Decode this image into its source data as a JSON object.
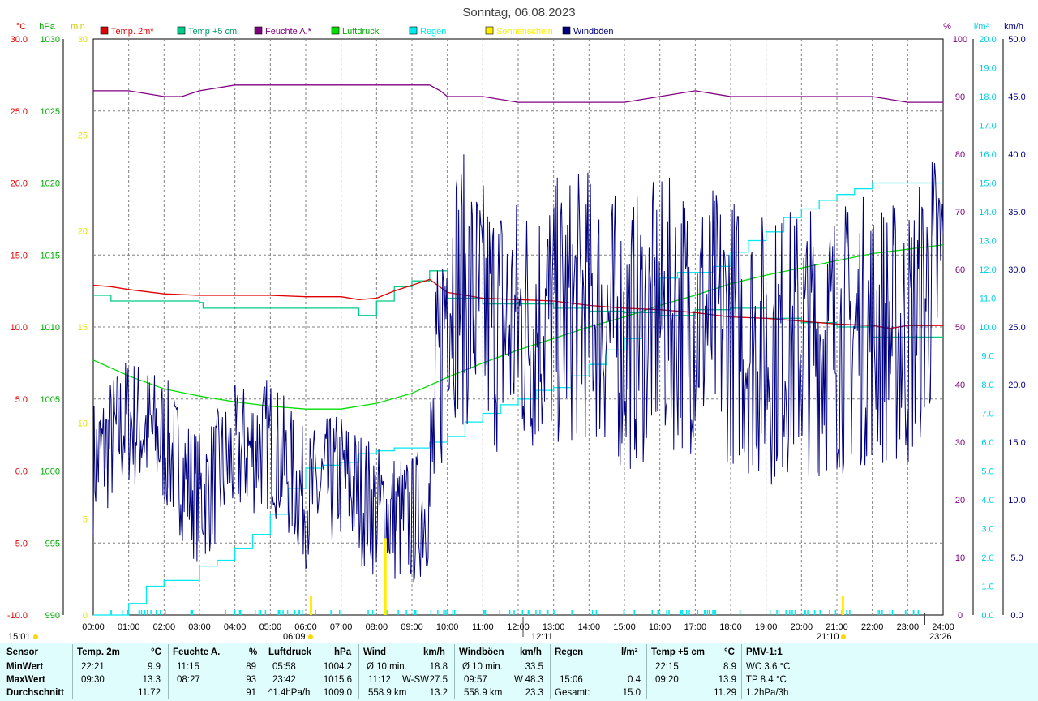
{
  "title": "Sonntag, 06.08.2023",
  "colors": {
    "temp2m": "#e00000",
    "temp5cm": "#00cc88",
    "humidity": "#800080",
    "pressure": "#00dd00",
    "rain": "#00e8f0",
    "sun": "#ffee00",
    "gusts": "#000080",
    "grid": "#808080"
  },
  "legend": [
    {
      "label": "Temp. 2m*",
      "color": "#e00000"
    },
    {
      "label": "Temp +5 cm",
      "color": "#00cc88"
    },
    {
      "label": "Feuchte A.*",
      "color": "#800080"
    },
    {
      "label": "Luftdruck",
      "color": "#00dd00"
    },
    {
      "label": "Regen",
      "color": "#00e8f0"
    },
    {
      "label": "Sonnenschein",
      "color": "#ffee00"
    },
    {
      "label": "Windböen",
      "color": "#000080"
    }
  ],
  "axes": {
    "temp": {
      "unit": "°C",
      "min": -10,
      "max": 30,
      "ticks": [
        "30.0",
        "25.0",
        "20.0",
        "15.0",
        "10.0",
        "5.0",
        "0.0",
        "-5.0",
        "-10.0"
      ]
    },
    "pressure": {
      "unit": "hPa",
      "min": 990,
      "max": 1030,
      "ticks": [
        "1030",
        "1025",
        "1020",
        "1015",
        "1010",
        "1005",
        "1000",
        "995",
        "990"
      ]
    },
    "sun": {
      "unit": "min",
      "min": 0,
      "max": 30,
      "ticks": [
        "30",
        "25",
        "20",
        "15",
        "10",
        "5",
        "0"
      ]
    },
    "humidity": {
      "unit": "%",
      "min": 0,
      "max": 100,
      "ticks": [
        "100",
        "90",
        "80",
        "70",
        "60",
        "50",
        "40",
        "30",
        "20",
        "10",
        "0"
      ]
    },
    "rain": {
      "unit": "l/m²",
      "min": 0,
      "max": 20,
      "ticks": [
        "20.0",
        "19.0",
        "18.0",
        "17.0",
        "16.0",
        "15.0",
        "14.0",
        "13.0",
        "12.0",
        "11.0",
        "10.0",
        "9.0",
        "8.0",
        "7.0",
        "6.0",
        "5.0",
        "4.0",
        "3.0",
        "2.0",
        "1.0",
        "0.0"
      ]
    },
    "wind": {
      "unit": "km/h",
      "min": 0,
      "max": 50,
      "ticks": [
        "50.0",
        "45.0",
        "40.0",
        "35.0",
        "30.0",
        "25.0",
        "20.0",
        "15.0",
        "10.0",
        "5.0",
        "0.0"
      ]
    },
    "x_ticks": [
      "00:00",
      "01:00",
      "02:00",
      "03:00",
      "04:00",
      "05:00",
      "06:00",
      "07:00",
      "08:00",
      "09:00",
      "10:00",
      "11:00",
      "12:00",
      "13:00",
      "14:00",
      "15:00",
      "16:00",
      "17:00",
      "18:00",
      "19:00",
      "20:00",
      "21:00",
      "22:00",
      "23:00",
      "24:00"
    ]
  },
  "markers": {
    "sunrise": "06:09",
    "noon": "12:11",
    "sunset": "21:10",
    "other": "23:26",
    "time": "15:01"
  },
  "chart_data": {
    "type": "line",
    "x_unit": "hour",
    "series": [
      {
        "name": "Temp. 2m*",
        "axis": "temp",
        "x": [
          0,
          0.5,
          1,
          2,
          3,
          4,
          5,
          6,
          7,
          7.5,
          8,
          8.5,
          9,
          9.5,
          10,
          11,
          12,
          13,
          14,
          15,
          16,
          17,
          18,
          19,
          20,
          21,
          22,
          22.5,
          23,
          24
        ],
        "y": [
          12.9,
          12.8,
          12.6,
          12.3,
          12.2,
          12.2,
          12.2,
          12.1,
          12.1,
          11.9,
          12.0,
          12.5,
          12.9,
          13.3,
          12.4,
          12.0,
          11.9,
          11.8,
          11.5,
          11.3,
          11.2,
          11.0,
          10.7,
          10.6,
          10.4,
          10.2,
          10.1,
          9.9,
          10.1,
          10.1
        ]
      },
      {
        "name": "Temp +5 cm",
        "axis": "temp",
        "x": [
          0,
          0.5,
          1,
          2,
          3,
          3.1,
          4,
          5,
          6,
          7,
          7.5,
          8,
          8.5,
          9,
          9.5,
          10,
          11,
          12,
          13,
          14,
          15,
          16,
          17,
          18,
          19,
          20,
          21,
          22,
          23,
          24
        ],
        "y": [
          12.2,
          11.8,
          11.8,
          11.8,
          11.7,
          11.3,
          11.3,
          11.3,
          11.3,
          11.3,
          10.8,
          11.8,
          12.8,
          13.2,
          13.9,
          12.0,
          11.6,
          11.6,
          11.3,
          11.1,
          11.0,
          10.8,
          11.2,
          11.3,
          10.6,
          10.3,
          10.0,
          9.3,
          9.3,
          9.3
        ]
      },
      {
        "name": "Feuchte A.*",
        "axis": "humidity",
        "x": [
          0,
          1,
          2,
          2.5,
          3,
          4,
          5,
          6,
          7,
          8,
          9,
          9.5,
          9.8,
          10,
          11,
          12,
          13,
          14,
          15,
          16,
          17,
          18,
          19,
          20,
          21,
          22,
          23,
          24
        ],
        "y": [
          91,
          91,
          90,
          90,
          91,
          92,
          92,
          92,
          92,
          92,
          92,
          92,
          91,
          90,
          90,
          89,
          89,
          89,
          89,
          90,
          91,
          90,
          90,
          90,
          90,
          90,
          89,
          89
        ]
      },
      {
        "name": "Luftdruck",
        "axis": "pressure",
        "x": [
          0,
          1,
          2,
          3,
          4,
          5,
          6,
          7,
          8,
          9,
          10,
          11,
          12,
          13,
          14,
          15,
          16,
          17,
          18,
          19,
          20,
          21,
          22,
          23,
          24
        ],
        "y": [
          1007.7,
          1006.6,
          1005.7,
          1005.2,
          1004.8,
          1004.5,
          1004.3,
          1004.3,
          1004.7,
          1005.4,
          1006.5,
          1007.5,
          1008.4,
          1009.2,
          1010.0,
          1010.7,
          1011.5,
          1012.2,
          1013.0,
          1013.6,
          1014.1,
          1014.6,
          1015.1,
          1015.4,
          1015.7
        ]
      },
      {
        "name": "Regen",
        "axis": "rain",
        "x": [
          0,
          0.5,
          1,
          1.5,
          2,
          2.5,
          3,
          3.5,
          4,
          4.5,
          5,
          5.5,
          6,
          6.5,
          7,
          7.5,
          8,
          8.5,
          9,
          9.5,
          10,
          10.5,
          11,
          11.5,
          12,
          12.5,
          13,
          13.5,
          14,
          14.5,
          15,
          15.5,
          16,
          16.5,
          17,
          17.5,
          18,
          18.5,
          19,
          19.5,
          20,
          20.5,
          21,
          21.5,
          22,
          23,
          24
        ],
        "y": [
          0,
          0,
          0.4,
          1,
          1.2,
          1.2,
          1.7,
          1.9,
          2.3,
          2.8,
          3.5,
          4.4,
          5.1,
          5.2,
          5.3,
          5.6,
          5.7,
          5.8,
          5.8,
          6.0,
          6.2,
          6.7,
          7.0,
          7.3,
          7.5,
          7.8,
          7.9,
          8.3,
          8.7,
          9.2,
          9.6,
          10.5,
          11.7,
          11.9,
          11.9,
          12.1,
          12.6,
          13.0,
          13.3,
          13.8,
          14.1,
          14.4,
          14.6,
          14.8,
          15.0,
          15.0,
          15.0
        ]
      },
      {
        "name": "Windböen",
        "axis": "wind",
        "x": [
          0,
          1,
          2,
          3,
          4,
          5,
          6,
          7,
          8,
          9,
          9.5,
          10,
          11,
          12,
          13,
          14,
          15,
          16,
          17,
          18,
          19,
          20,
          21,
          22,
          23,
          24
        ],
        "y": [
          13,
          17,
          15,
          10,
          14,
          15,
          10,
          12,
          9,
          8,
          10,
          30,
          26,
          25,
          26,
          27,
          24,
          26,
          26,
          25,
          23,
          24,
          24,
          25,
          24,
          31
        ]
      },
      {
        "name": "Sonnenschein",
        "axis": "sun",
        "x": [
          6.15,
          8.25,
          21.17
        ],
        "y": [
          1,
          4,
          1
        ]
      }
    ]
  },
  "table": {
    "headers": [
      {
        "name": "Sensor",
        "unit": ""
      },
      {
        "name": "Temp. 2m",
        "unit": "°C"
      },
      {
        "name": "Feuchte A.",
        "unit": "%"
      },
      {
        "name": "Luftdruck",
        "unit": "hPa"
      },
      {
        "name": "Wind",
        "unit": "km/h"
      },
      {
        "name": "Windböen",
        "unit": "km/h"
      },
      {
        "name": "Regen",
        "unit": "l/m²"
      },
      {
        "name": "Temp +5 cm",
        "unit": "°C"
      },
      {
        "name": "PMV-1:1",
        "unit": ""
      }
    ],
    "row_labels": [
      "MinWert",
      "MaxWert",
      "Durchschnitt"
    ],
    "temp2m": [
      [
        "22:21",
        "9.9"
      ],
      [
        "09:30",
        "13.3"
      ],
      [
        "",
        "11.72"
      ]
    ],
    "humidity": [
      [
        "11:15",
        "89"
      ],
      [
        "08:27",
        "93"
      ],
      [
        "",
        "91"
      ]
    ],
    "pressure": [
      [
        "05:58",
        "1004.2"
      ],
      [
        "23:42",
        "1015.6"
      ],
      [
        "^1.4hPa/h",
        "1009.0"
      ]
    ],
    "wind": [
      [
        "Ø 10 min.",
        "",
        "18.8"
      ],
      [
        "11:12",
        "W-SW",
        "27.5"
      ],
      [
        "558.9 km",
        "",
        "13.2"
      ]
    ],
    "gusts": [
      [
        "Ø 10 min.",
        "",
        "33.5"
      ],
      [
        "09:57",
        "W",
        "48.3"
      ],
      [
        "558.9 km",
        "",
        "23.3"
      ]
    ],
    "rain": [
      [
        "",
        ""
      ],
      [
        "15:06",
        "0.4"
      ],
      [
        "Gesamt:",
        "15.0"
      ]
    ],
    "temp5cm": [
      [
        "22:15",
        "8.9"
      ],
      [
        "09:20",
        "13.9"
      ],
      [
        "",
        "11.29"
      ]
    ],
    "pmv": [
      "WC 3.6 °C",
      "TP 8.4 °C",
      "1.2hPa/3h"
    ]
  }
}
